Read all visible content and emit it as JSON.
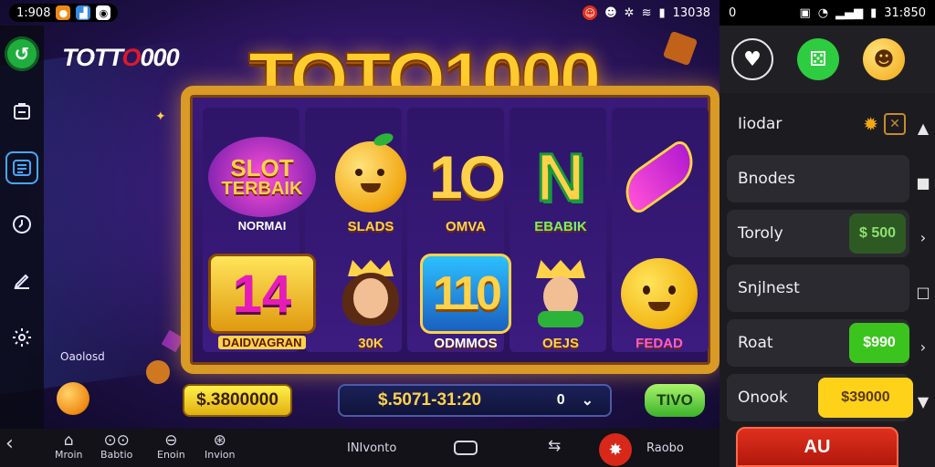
{
  "status_left": {
    "time": "1:908",
    "right_time": "13038"
  },
  "status_right": {
    "battery": "0",
    "time": "31:850"
  },
  "brand": {
    "prefix": "TOTT",
    "o": "O",
    "suffix": "000"
  },
  "big_title": "TOTO1000",
  "symbols": {
    "slot_terbaik": {
      "line1": "SLOT",
      "line2": "TERBAIK",
      "label": "NORMAI"
    },
    "orange": {
      "label": "SLADS"
    },
    "ten": {
      "art": "1O",
      "label": "OMVA"
    },
    "n_gem": {
      "art": "N",
      "label": "EBABIK"
    },
    "fourteen": {
      "art": "14",
      "label": "DAIDVAGRAN"
    },
    "queen": {
      "label": "30K"
    },
    "hundred": {
      "art": "110",
      "label": "ODMMOS"
    },
    "king": {
      "label": "OEJS"
    },
    "smiley": {
      "label": "FEDAD"
    }
  },
  "fruit_label": "Oaolosd",
  "balance": "$.3800000",
  "bet": {
    "value": "$.5071-31:20",
    "ctl_left": "0",
    "ctl_right": "✓"
  },
  "spin_label": "TIVO",
  "bottom_bar": {
    "items": [
      {
        "glyph": "⌂",
        "label": "Mroin"
      },
      {
        "glyph": "⊙⊙",
        "label": "Babtio"
      },
      {
        "glyph": "⊖",
        "label": "Enoin"
      },
      {
        "glyph": "⊛",
        "label": "Invion"
      }
    ],
    "center_label": "INIvonto",
    "right_label": "Raobo"
  },
  "right_panel": {
    "rows": [
      {
        "label": "Iiodar",
        "value": ""
      },
      {
        "label": "Bnodes",
        "value": ""
      },
      {
        "label": "Toroly",
        "value": "$ 500"
      },
      {
        "label": "Snjlnest",
        "value": ""
      },
      {
        "label": "Roat",
        "value": "$990"
      },
      {
        "label": "Onook",
        "value": "$39000"
      }
    ],
    "au_button": "AU"
  },
  "colors": {
    "accent_gold": "#ffcd2e",
    "accent_green": "#3cc41e",
    "accent_red": "#e0301e",
    "panel_bg": "#1c1c20"
  }
}
